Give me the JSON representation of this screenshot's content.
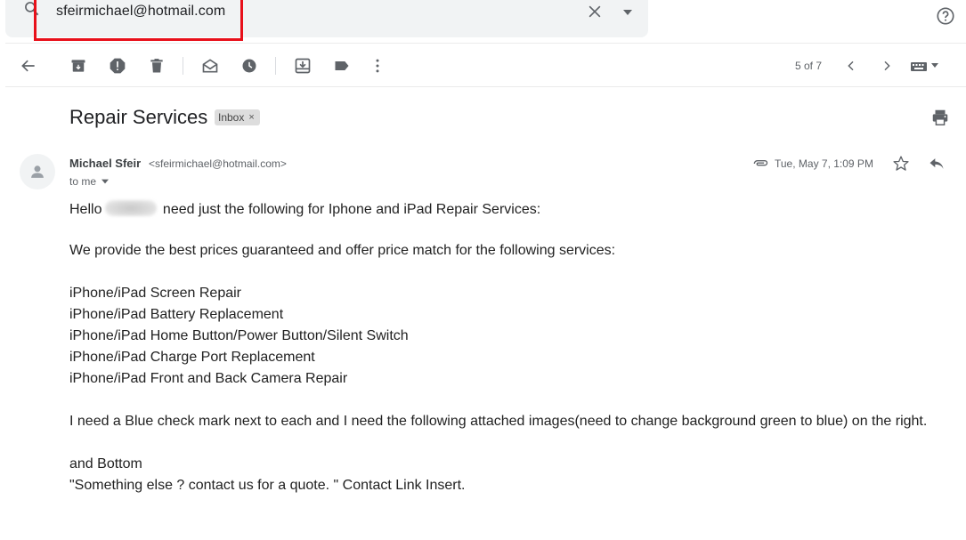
{
  "search": {
    "value": "sfeirmichael@hotmail.com"
  },
  "toolbar": {
    "page_count": "5 of 7"
  },
  "email": {
    "subject": "Repair Services",
    "label": "Inbox",
    "label_close": "×",
    "sender_name": "Michael Sfeir",
    "sender_email": "<sfeirmichael@hotmail.com>",
    "to": "to me",
    "date": "Tue, May 7, 1:09 PM",
    "body": {
      "greeting_before": "Hello",
      "greeting_after": "need just the following for Iphone and iPad Repair Services:",
      "line1": "We provide the best prices guaranteed and offer price match for the following services:",
      "services": [
        "iPhone/iPad Screen Repair",
        "iPhone/iPad Battery Replacement",
        "iPhone/iPad Home Button/Power Button/Silent Switch",
        "iPhone/iPad Charge Port Replacement",
        "iPhone/iPad Front and Back Camera Repair"
      ],
      "line2": "I need a Blue check mark next to each and I need the following attached images(need to change background green to blue) on the right.",
      "line3": "and Bottom",
      "line4": "\"Something else ? contact us for a quote. \" Contact Link Insert."
    }
  },
  "colors": {
    "highlight": "#e8101a",
    "icon": "#5f6368",
    "search_bg": "#f1f3f4"
  },
  "icons": [
    "search-icon",
    "close-icon",
    "dropdown-icon",
    "help-icon",
    "back-arrow-icon",
    "archive-icon",
    "report-spam-icon",
    "delete-icon",
    "mark-unread-icon",
    "snooze-icon",
    "move-to-icon",
    "label-icon",
    "more-vert-icon",
    "chevron-left-icon",
    "chevron-right-icon",
    "keyboard-icon",
    "print-icon",
    "avatar-icon",
    "attachment-icon",
    "star-icon",
    "reply-icon"
  ]
}
